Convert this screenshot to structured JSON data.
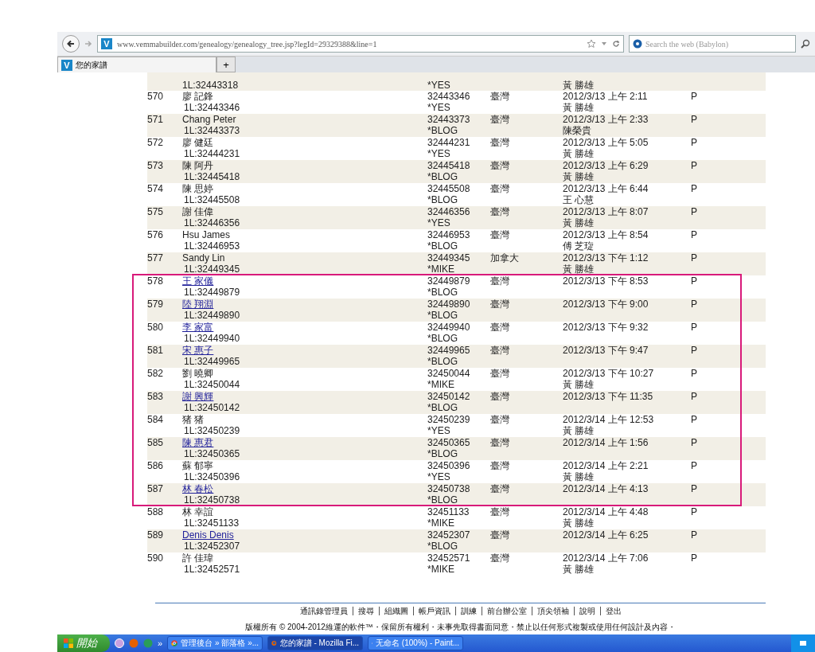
{
  "browser": {
    "site_letter": "V",
    "url": "www.vemmabuilder.com/genealogy/genealogy_tree.jsp?legId=29329388&line=1",
    "search_placeholder": "Search the web (Babylon)",
    "tabs": [
      {
        "icon_letter": "V",
        "title": "您的家譜",
        "selected": true
      }
    ],
    "new_tab": "+"
  },
  "rows": [
    {
      "kind": "partial",
      "leg": "1L:32443318",
      "source": "*YES",
      "sponsor": "黃 勝雄"
    },
    {
      "kind": "full",
      "no": "570",
      "name": "廖 記鋒",
      "link": false,
      "leg": "1L:32443346",
      "id": "32443346",
      "source": "*YES",
      "country": "臺灣",
      "date": "2012/3/13 上午 2:11",
      "sponsor": "黃 勝雄",
      "status": "P"
    },
    {
      "kind": "full",
      "no": "571",
      "name": "Chang Peter",
      "link": false,
      "leg": "1L:32443373",
      "id": "32443373",
      "source": "*BLOG",
      "country": "臺灣",
      "date": "2012/3/13 上午 2:33",
      "sponsor": "陳榮貴",
      "status": "P"
    },
    {
      "kind": "full",
      "no": "572",
      "name": "廖 健廷",
      "link": false,
      "leg": "1L:32444231",
      "id": "32444231",
      "source": "*YES",
      "country": "臺灣",
      "date": "2012/3/13 上午 5:05",
      "sponsor": "黃 勝雄",
      "status": "P"
    },
    {
      "kind": "full",
      "no": "573",
      "name": "陳 阿丹",
      "link": false,
      "leg": "1L:32445418",
      "id": "32445418",
      "source": "*BLOG",
      "country": "臺灣",
      "date": "2012/3/13 上午 6:29",
      "sponsor": "黃 勝雄",
      "status": "P"
    },
    {
      "kind": "full",
      "no": "574",
      "name": "陳 思婷",
      "link": false,
      "leg": "1L:32445508",
      "id": "32445508",
      "source": "*BLOG",
      "country": "臺灣",
      "date": "2012/3/13 上午 6:44",
      "sponsor": "王 心慧",
      "status": "P"
    },
    {
      "kind": "full",
      "no": "575",
      "name": "謝 佳偉",
      "link": false,
      "leg": "1L:32446356",
      "id": "32446356",
      "source": "*YES",
      "country": "臺灣",
      "date": "2012/3/13 上午 8:07",
      "sponsor": "黃 勝雄",
      "status": "P"
    },
    {
      "kind": "full",
      "no": "576",
      "name": "Hsu James",
      "link": false,
      "leg": "1L:32446953",
      "id": "32446953",
      "source": "*BLOG",
      "country": "臺灣",
      "date": "2012/3/13 上午 8:54",
      "sponsor": "傅 芝琁",
      "status": "P"
    },
    {
      "kind": "full",
      "no": "577",
      "name": "Sandy Lin",
      "link": false,
      "leg": "1L:32449345",
      "id": "32449345",
      "source": "*MIKE",
      "country": "加拿大",
      "date": "2012/3/13 下午 1:12",
      "sponsor": "黃 勝雄",
      "status": "P"
    },
    {
      "kind": "full",
      "no": "578",
      "name": "王 家儀",
      "link": true,
      "leg": "1L:32449879",
      "id": "32449879",
      "source": "*BLOG",
      "country": "臺灣",
      "date": "2012/3/13 下午 8:53",
      "status": "P"
    },
    {
      "kind": "full",
      "no": "579",
      "name": "陸 翔淵",
      "link": true,
      "leg": "1L:32449890",
      "id": "32449890",
      "source": "*BLOG",
      "country": "臺灣",
      "date": "2012/3/13 下午 9:00",
      "status": "P"
    },
    {
      "kind": "full",
      "no": "580",
      "name": "李 家富",
      "link": true,
      "leg": "1L:32449940",
      "id": "32449940",
      "source": "*BLOG",
      "country": "臺灣",
      "date": "2012/3/13 下午 9:32",
      "status": "P"
    },
    {
      "kind": "full",
      "no": "581",
      "name": "宋 惠子",
      "link": true,
      "leg": "1L:32449965",
      "id": "32449965",
      "source": "*BLOG",
      "country": "臺灣",
      "date": "2012/3/13 下午 9:47",
      "status": "P"
    },
    {
      "kind": "full",
      "no": "582",
      "name": "劉 曉卿",
      "link": false,
      "leg": "1L:32450044",
      "id": "32450044",
      "source": "*MIKE",
      "country": "臺灣",
      "date": "2012/3/13 下午 10:27",
      "sponsor": "黃 勝雄",
      "status": "P"
    },
    {
      "kind": "full",
      "no": "583",
      "name": "謝 興輝",
      "link": true,
      "leg": "1L:32450142",
      "id": "32450142",
      "source": "*BLOG",
      "country": "臺灣",
      "date": "2012/3/13 下午 11:35",
      "status": "P"
    },
    {
      "kind": "full",
      "no": "584",
      "name": "猪 猪",
      "link": false,
      "leg": "1L:32450239",
      "id": "32450239",
      "source": "*YES",
      "country": "臺灣",
      "date": "2012/3/14 上午 12:53",
      "sponsor": "黃 勝雄",
      "status": "P"
    },
    {
      "kind": "full",
      "no": "585",
      "name": "陳 惠君",
      "link": true,
      "leg": "1L:32450365",
      "id": "32450365",
      "source": "*BLOG",
      "country": "臺灣",
      "date": "2012/3/14 上午 1:56",
      "status": "P"
    },
    {
      "kind": "full",
      "no": "586",
      "name": "蘇 郁寧",
      "link": false,
      "leg": "1L:32450396",
      "id": "32450396",
      "source": "*YES",
      "country": "臺灣",
      "date": "2012/3/14 上午 2:21",
      "sponsor": "黃 勝雄",
      "status": "P"
    },
    {
      "kind": "full",
      "no": "587",
      "name": "林 春松",
      "link": true,
      "leg": "1L:32450738",
      "id": "32450738",
      "source": "*BLOG",
      "country": "臺灣",
      "date": "2012/3/14 上午 4:13",
      "status": "P"
    },
    {
      "kind": "full",
      "no": "588",
      "name": "林 幸誼",
      "link": false,
      "leg": "1L:32451133",
      "id": "32451133",
      "source": "*MIKE",
      "country": "臺灣",
      "date": "2012/3/14 上午 4:48",
      "sponsor": "黃 勝雄",
      "status": "P"
    },
    {
      "kind": "full",
      "no": "589",
      "name": "Denis Denis",
      "link": true,
      "leg": "1L:32452307",
      "id": "32452307",
      "source": "*BLOG",
      "country": "臺灣",
      "date": "2012/3/14 上午 6:25",
      "status": "P"
    },
    {
      "kind": "full",
      "no": "590",
      "name": "許 佳瑋",
      "link": false,
      "leg": "1L:32452571",
      "id": "32452571",
      "source": "*MIKE",
      "country": "臺灣",
      "date": "2012/3/14 上午 7:06",
      "sponsor": "黃 勝雄",
      "status": "P"
    }
  ],
  "footer": {
    "links": [
      "通訊錄管理員",
      "搜尋",
      "組織圖",
      "帳戶資訊",
      "訓練",
      "前台辦公室",
      "頂尖領袖",
      "說明",
      "登出"
    ],
    "copyright": "版權所有 © 2004-2012維運的軟件™・保留所有權利・未事先取得書面同意・禁止以任何形式複製或使用任何設計及內容・"
  },
  "taskbar": {
    "start": "開始",
    "overflow": "»",
    "tasks": [
      {
        "kind": "chrome",
        "title": "管理後台 » 部落格 »...",
        "selected": false
      },
      {
        "kind": "firefox",
        "title": "您的家譜 - Mozilla Fi...",
        "selected": true
      },
      {
        "kind": "paint",
        "title": "无命名 (100%) - Paint...",
        "selected": false
      }
    ]
  }
}
